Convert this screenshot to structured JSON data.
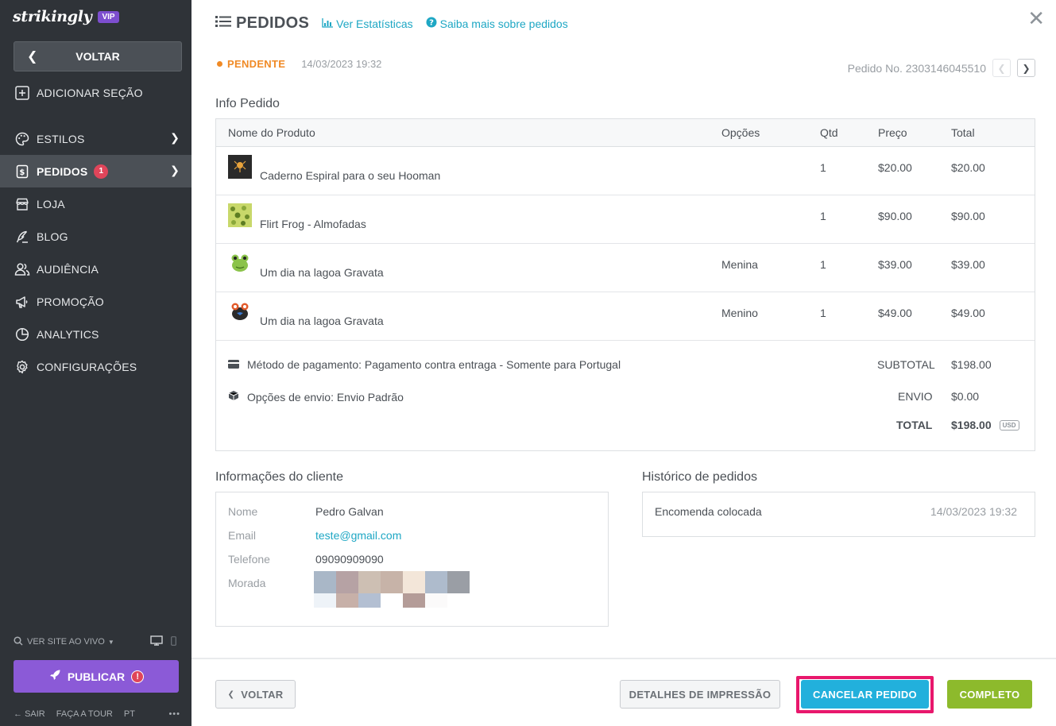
{
  "brand": {
    "logo": "strikingly",
    "tier": "VIP"
  },
  "sidebar": {
    "back_label": "VOLTAR",
    "add_section": "ADICIONAR SEÇÃO",
    "items": [
      {
        "label": "ESTILOS",
        "icon": "palette-icon"
      },
      {
        "label": "PEDIDOS",
        "icon": "dollar-doc-icon",
        "badge": "1"
      },
      {
        "label": "LOJA",
        "icon": "store-icon"
      },
      {
        "label": "BLOG",
        "icon": "pen-icon"
      },
      {
        "label": "AUDIÊNCIA",
        "icon": "users-icon"
      },
      {
        "label": "PROMOÇÃO",
        "icon": "megaphone-icon"
      },
      {
        "label": "ANALYTICS",
        "icon": "chart-pie-icon"
      },
      {
        "label": "CONFIGURAÇÕES",
        "icon": "gear-icon"
      }
    ],
    "live": "VER SITE AO VIVO",
    "publish": "PUBLICAR",
    "footer": {
      "exit": "SAIR",
      "tour": "FAÇA A TOUR",
      "lang": "PT",
      "more": "•••"
    }
  },
  "header": {
    "title": "PEDIDOS",
    "stats_link": "Ver Estatísticas",
    "help_link": "Saiba mais sobre pedidos"
  },
  "order": {
    "status": "PENDENTE",
    "date": "14/03/2023 19:32",
    "number_label": "Pedido No. 2303146045510",
    "status_color": "#f08a25"
  },
  "info": {
    "title": "Info Pedido",
    "columns": {
      "product": "Nome do Produto",
      "options": "Opções",
      "qty": "Qtd",
      "price": "Preço",
      "total": "Total"
    },
    "rows": [
      {
        "name": "Caderno Espiral para o seu Hooman",
        "option": "",
        "qty": "1",
        "price": "$20.00",
        "total": "$20.00"
      },
      {
        "name": "Flirt Frog - Almofadas",
        "option": "",
        "qty": "1",
        "price": "$90.00",
        "total": "$90.00"
      },
      {
        "name": "Um dia na lagoa Gravata",
        "option": "Menina",
        "qty": "1",
        "price": "$39.00",
        "total": "$39.00"
      },
      {
        "name": "Um dia na lagoa Gravata",
        "option": "Menino",
        "qty": "1",
        "price": "$49.00",
        "total": "$49.00"
      }
    ],
    "payment": "Método de pagamento: Pagamento contra entraga - Somente para Portugal",
    "shipping": "Opções de envio: Envio Padrão",
    "subtotal_label": "SUBTOTAL",
    "subtotal": "$198.00",
    "shipping_label": "ENVIO",
    "shipping_cost": "$0.00",
    "total_label": "TOTAL",
    "total": "$198.00",
    "currency": "USD"
  },
  "client": {
    "title": "Informações do cliente",
    "name_label": "Nome",
    "name": "Pedro Galvan",
    "email_label": "Email",
    "email": "teste@gmail.com",
    "phone_label": "Telefone",
    "phone": "09090909090",
    "address_label": "Morada"
  },
  "history": {
    "title": "Histórico de pedidos",
    "event": "Encomenda colocada",
    "date": "14/03/2023 19:32"
  },
  "actions": {
    "back": "VOLTAR",
    "print": "DETALHES DE IMPRESSÃO",
    "cancel": "CANCELAR PEDIDO",
    "complete": "COMPLETO",
    "highlight_color": "#e8176c"
  }
}
